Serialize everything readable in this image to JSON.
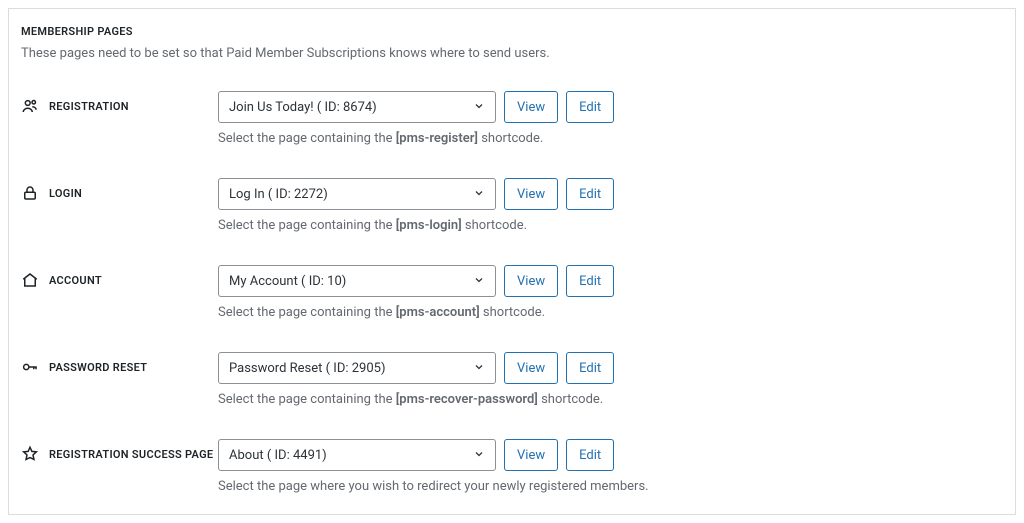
{
  "section": {
    "title": "MEMBERSHIP PAGES",
    "description": "These pages need to be set so that Paid Member Subscriptions knows where to send users."
  },
  "buttons": {
    "view": "View",
    "edit": "Edit"
  },
  "rows": {
    "registration": {
      "label": "REGISTRATION",
      "value": "Join Us Today! ( ID: 8674)",
      "helper_before": "Select the page containing the ",
      "helper_bold": "[pms-register]",
      "helper_after": " shortcode."
    },
    "login": {
      "label": "LOGIN",
      "value": "Log In ( ID: 2272)",
      "helper_before": "Select the page containing the ",
      "helper_bold": "[pms-login]",
      "helper_after": " shortcode."
    },
    "account": {
      "label": "ACCOUNT",
      "value": "My Account ( ID: 10)",
      "helper_before": "Select the page containing the ",
      "helper_bold": "[pms-account]",
      "helper_after": " shortcode."
    },
    "password_reset": {
      "label": "PASSWORD RESET",
      "value": "Password Reset ( ID: 2905)",
      "helper_before": "Select the page containing the ",
      "helper_bold": "[pms-recover-password]",
      "helper_after": " shortcode."
    },
    "success": {
      "label": "REGISTRATION SUCCESS PAGE",
      "value": "About ( ID: 4491)",
      "helper_before": "Select the page where you wish to redirect your newly registered members.",
      "helper_bold": "",
      "helper_after": ""
    }
  }
}
